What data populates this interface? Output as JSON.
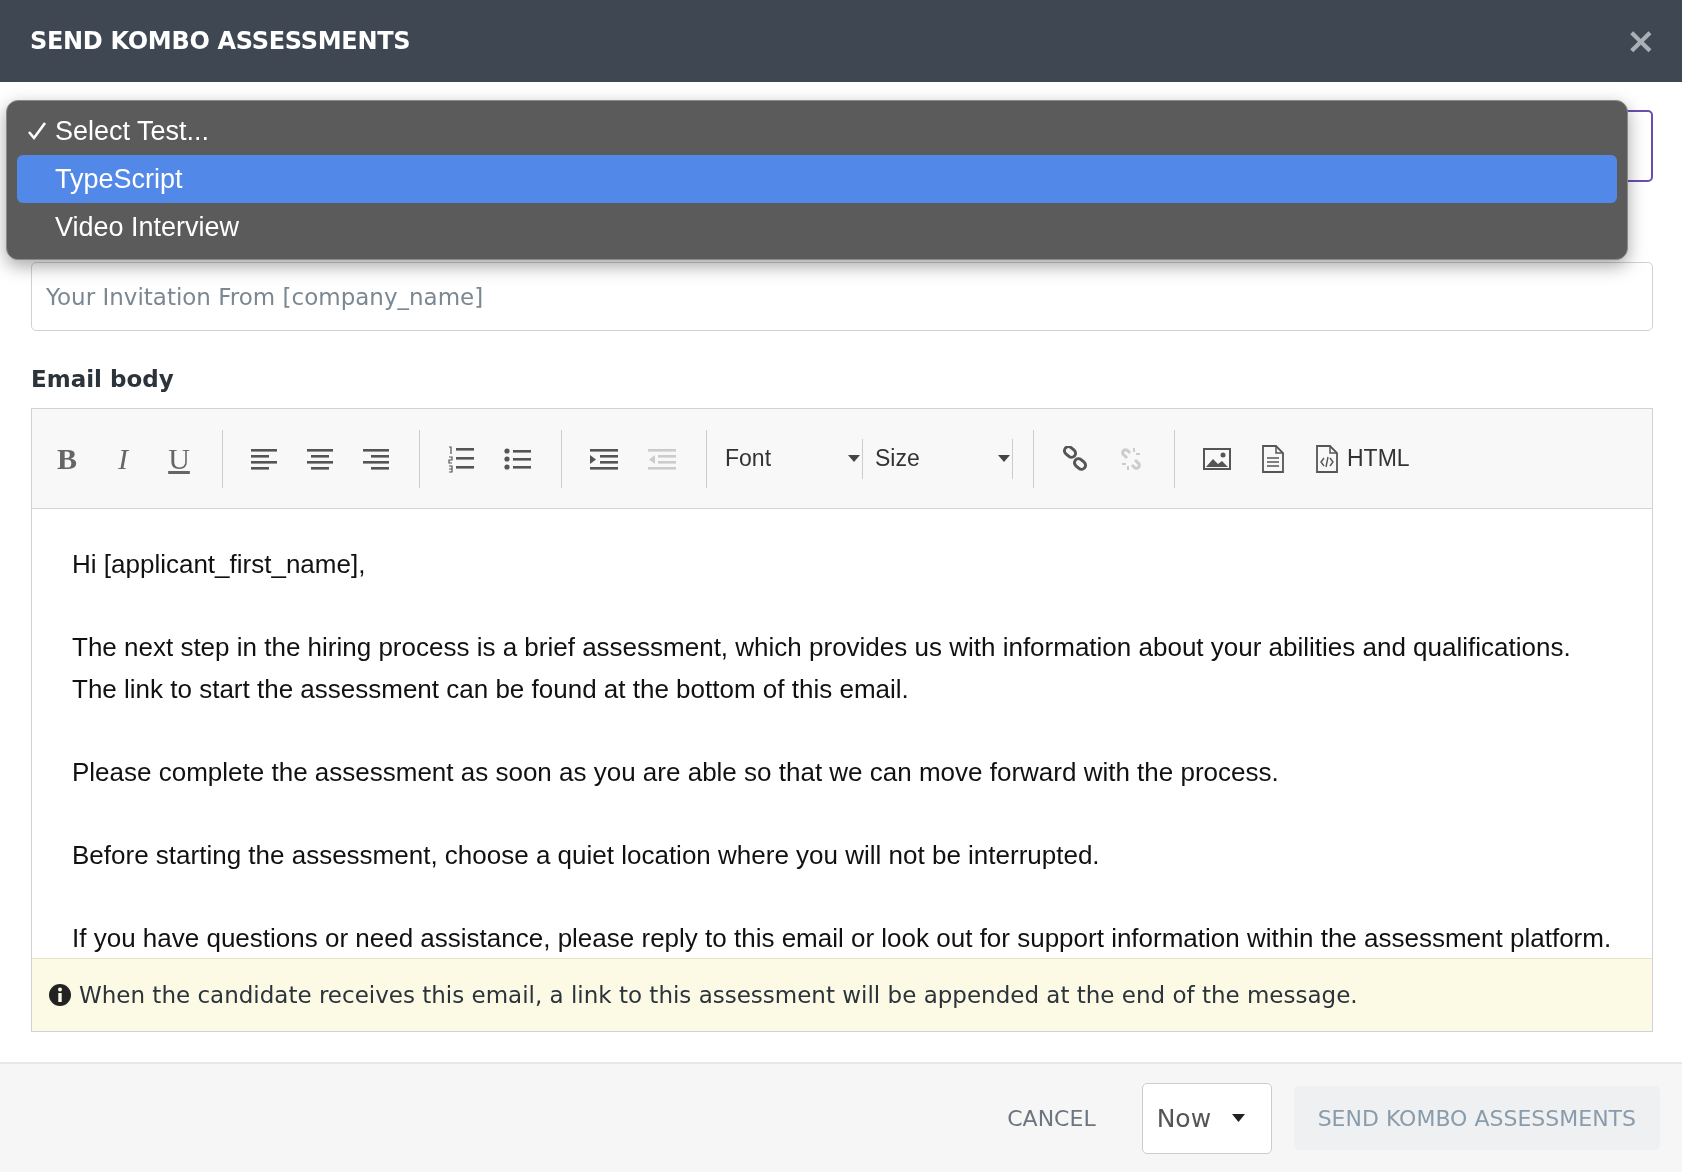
{
  "dialog": {
    "title": "SEND KOMBO ASSESSMENTS",
    "close": "×"
  },
  "test_dropdown": {
    "options": [
      {
        "label": "Select Test...",
        "checked": true,
        "selected": false
      },
      {
        "label": "TypeScript",
        "checked": false,
        "selected": true
      },
      {
        "label": "Video Interview",
        "checked": false,
        "selected": false
      }
    ]
  },
  "subject": {
    "placeholder": "Your Invitation From [company_name]"
  },
  "email_body": {
    "label": "Email body",
    "toolbar": [
      [
        {
          "kind": "bold",
          "label": "B",
          "disabled": false
        },
        {
          "kind": "italic",
          "label": "I",
          "disabled": false
        },
        {
          "kind": "underline",
          "label": "U",
          "disabled": false
        }
      ],
      [
        {
          "kind": "align-left",
          "disabled": false
        },
        {
          "kind": "align-center",
          "disabled": false
        },
        {
          "kind": "align-right",
          "disabled": false
        }
      ],
      [
        {
          "kind": "ordered-list",
          "disabled": false
        },
        {
          "kind": "bullet-list",
          "disabled": false
        }
      ],
      [
        {
          "kind": "indent",
          "disabled": false
        },
        {
          "kind": "outdent",
          "disabled": true
        }
      ],
      [
        {
          "kind": "select",
          "label": "Font",
          "disabled": false
        },
        {
          "kind": "select",
          "label": "Size",
          "disabled": false
        }
      ],
      [
        {
          "kind": "link",
          "disabled": false
        },
        {
          "kind": "unlink",
          "disabled": true
        }
      ],
      [
        {
          "kind": "image",
          "disabled": false
        },
        {
          "kind": "document",
          "disabled": false
        },
        {
          "kind": "html",
          "label": "HTML",
          "disabled": false
        }
      ]
    ],
    "paragraphs": [
      "Hi [applicant_first_name],",
      "The next step in the hiring process is a brief assessment, which provides us with information about your abilities and qualifications. The link to start the assessment can be found at the bottom of this email.",
      "Please complete the assessment as soon as you are able so that we can move forward with the process.",
      "Before starting the assessment, choose a quiet location where you will not be interrupted.",
      "If you have questions or need assistance, please reply to this email or look out for support information within the assessment platform."
    ],
    "notice": "When the candidate receives this email, a link to this assessment will be appended at the end of the message."
  },
  "footer": {
    "cancel": "CANCEL",
    "schedule": "Now",
    "send": {
      "label": "SEND KOMBO ASSESSMENTS",
      "disabled": true
    }
  }
}
